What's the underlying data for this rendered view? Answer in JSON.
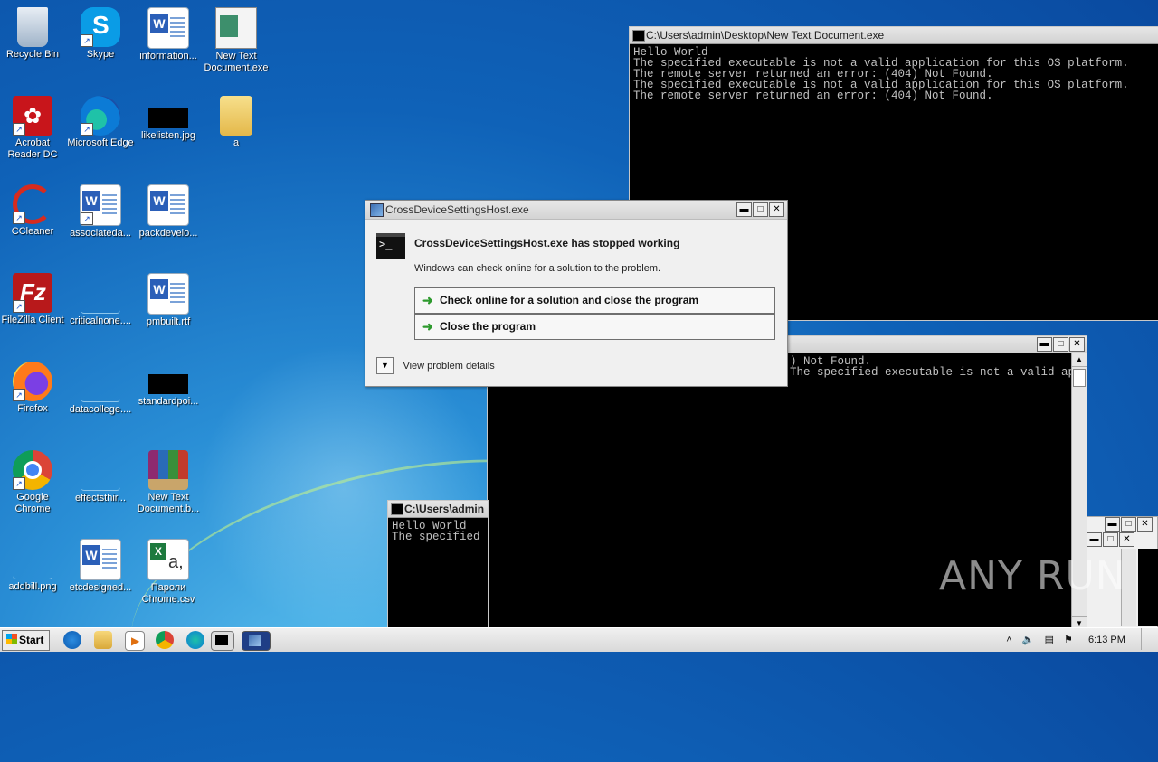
{
  "desktop": {
    "icons": [
      {
        "label": "Recycle Bin",
        "icon": "recycle-bin-icon"
      },
      {
        "label": "Skype",
        "icon": "skype-icon"
      },
      {
        "label": "information...",
        "icon": "word-doc-icon"
      },
      {
        "label": "New Text Document.exe",
        "icon": "exe-window-icon"
      },
      {
        "label": "Acrobat Reader DC",
        "icon": "acrobat-icon"
      },
      {
        "label": "Microsoft Edge",
        "icon": "edge-icon"
      },
      {
        "label": "likelisten.jpg",
        "icon": "image-file-icon"
      },
      {
        "label": "a",
        "icon": "folder-icon"
      },
      {
        "label": "CCleaner",
        "icon": "ccleaner-icon"
      },
      {
        "label": "associateda...",
        "icon": "word-doc-icon"
      },
      {
        "label": "packdevelo...",
        "icon": "word-doc-icon"
      },
      {
        "label": "FileZilla Client",
        "icon": "filezilla-icon"
      },
      {
        "label": "criticalnone....",
        "icon": "blank-file-icon"
      },
      {
        "label": "pmbuilt.rtf",
        "icon": "word-doc-icon"
      },
      {
        "label": "Firefox",
        "icon": "firefox-icon"
      },
      {
        "label": "datacollege....",
        "icon": "blank-file-icon"
      },
      {
        "label": "standardpoi...",
        "icon": "image-file-icon"
      },
      {
        "label": "Google Chrome",
        "icon": "chrome-icon"
      },
      {
        "label": "effectsthir...",
        "icon": "blank-file-icon"
      },
      {
        "label": "New Text Document.b...",
        "icon": "winrar-icon"
      },
      {
        "label": "addbill.png",
        "icon": "blank-file-icon"
      },
      {
        "label": "etcdesigned...",
        "icon": "word-doc-icon"
      },
      {
        "label": "Пароли Chrome.csv",
        "icon": "excel-csv-icon"
      }
    ]
  },
  "console_main": {
    "title": "C:\\Users\\admin\\Desktop\\New Text Document.exe",
    "output": "Hello World\nThe specified executable is not a valid application for this OS platform.\nThe remote server returned an error: (404) Not Found.\nThe specified executable is not a valid application for this OS platform.\nThe remote server returned an error: (404) Not Found."
  },
  "console_mid": {
    "output": ") Not Found.\nThe specified executable is not a valid application for this OS platform."
  },
  "console_small": {
    "title": "C:\\Users\\admin",
    "output": "Hello World\nThe specified"
  },
  "dialog": {
    "title": "CrossDeviceSettingsHost.exe",
    "heading": "CrossDeviceSettingsHost.exe has stopped working",
    "message": "Windows can check online for a solution to the problem.",
    "option_check": "Check online for a solution and close the program",
    "option_close": "Close the program",
    "details": "View problem details"
  },
  "taskbar": {
    "start_label": "Start",
    "clock": "6:13 PM"
  },
  "watermark": "ANY RUN"
}
